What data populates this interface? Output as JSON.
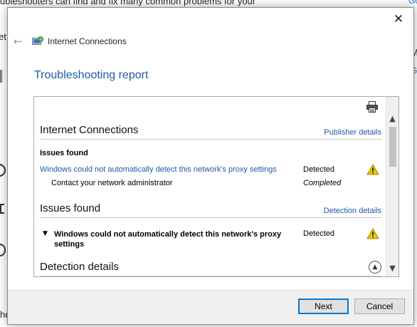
{
  "background": {
    "top_text": "ubleshooters can find and fix many common problems for your",
    "right_top": "Go",
    "right_m": "M",
    "right_gi": "Gi",
    "left_frag": "et"
  },
  "dialog": {
    "close_glyph": "✕",
    "back_glyph": "←",
    "app_title": "Internet Connections",
    "page_title": "Troubleshooting report",
    "report": {
      "section1": {
        "title": "Internet Connections",
        "link": "Publisher details"
      },
      "issues_found_label": "Issues found",
      "issue_row": {
        "text": "Windows could not automatically detect this network's proxy settings",
        "status": "Detected"
      },
      "action_row": {
        "text": "Contact your network administrator",
        "status": "Completed"
      },
      "section2": {
        "title": "Issues found",
        "link": "Detection details"
      },
      "detail_item": {
        "text": "Windows could not automatically detect this network's proxy settings",
        "status": "Detected"
      },
      "section3": {
        "title": "Detection details"
      },
      "scroll_up": "▲",
      "scroll_down": "▼"
    },
    "buttons": {
      "next": "Next",
      "cancel": "Cancel"
    }
  },
  "colors": {
    "accent_blue": "#1e5aa8",
    "warning_yellow": "#f5c400",
    "primary_border": "#0078d7"
  }
}
